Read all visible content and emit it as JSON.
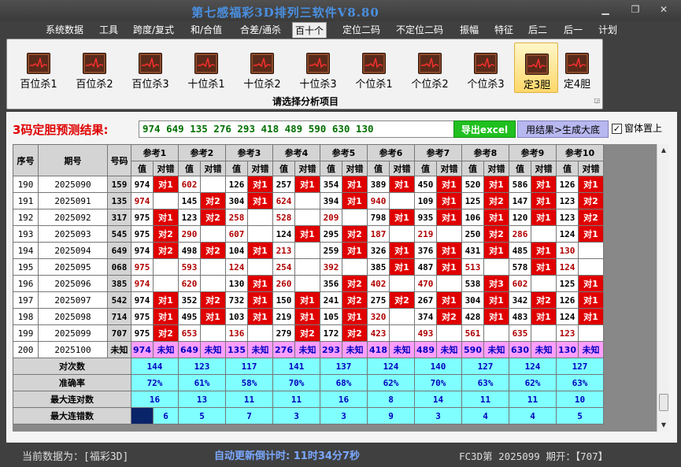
{
  "window": {
    "title": "第七感福彩3D排列三软件V8.80",
    "min_icon": "minimize-icon",
    "max_icon": "maximize-icon",
    "close_icon": "close-icon"
  },
  "menu": [
    "系统数据",
    "工具",
    "跨度/复式",
    "和/合值",
    "合差/通杀",
    "百十个",
    "定位二码",
    "不定位二码",
    "振幅",
    "特征",
    "后二",
    "后一",
    "计划"
  ],
  "menu_active": "百十个",
  "ribbon": {
    "buttons": [
      "百位杀1",
      "百位杀2",
      "百位杀3",
      "十位杀1",
      "十位杀2",
      "十位杀3",
      "个位杀1",
      "个位杀2",
      "个位杀3",
      "定3胆",
      "定4胆"
    ],
    "active": "定3胆",
    "caption": "请选择分析项目"
  },
  "prediction": {
    "label": "3码定胆预测结果:",
    "value": "974 649 135 276 293 418 489 590 630 130"
  },
  "buttons": {
    "export": "导出excel",
    "generate": "用结果>生成大底"
  },
  "ontop_label": "窗体置上",
  "ontop_checked": "✓",
  "table": {
    "headers": {
      "seq": "序号",
      "issue": "期号",
      "code": "号码",
      "value": "值",
      "check": "对错"
    },
    "refs": [
      "参考1",
      "参考2",
      "参考3",
      "参考4",
      "参考5",
      "参考6",
      "参考7",
      "参考8",
      "参考9",
      "参考10"
    ],
    "rows": [
      {
        "seq": "190",
        "issue": "2025090",
        "code": "159",
        "cells": [
          [
            "974",
            "对1"
          ],
          [
            "602",
            ""
          ],
          [
            "126",
            "对1"
          ],
          [
            "257",
            "对1"
          ],
          [
            "354",
            "对1"
          ],
          [
            "389",
            "对1"
          ],
          [
            "450",
            "对1"
          ],
          [
            "520",
            "对1"
          ],
          [
            "586",
            "对1"
          ],
          [
            "126",
            "对1"
          ]
        ]
      },
      {
        "seq": "191",
        "issue": "2025091",
        "code": "135",
        "cells": [
          [
            "974",
            ""
          ],
          [
            "145",
            "对2"
          ],
          [
            "304",
            "对1"
          ],
          [
            "624",
            ""
          ],
          [
            "394",
            "对1"
          ],
          [
            "940",
            ""
          ],
          [
            "109",
            "对1"
          ],
          [
            "125",
            "对2"
          ],
          [
            "147",
            "对1"
          ],
          [
            "123",
            "对2"
          ]
        ]
      },
      {
        "seq": "192",
        "issue": "2025092",
        "code": "317",
        "cells": [
          [
            "975",
            "对1"
          ],
          [
            "123",
            "对2"
          ],
          [
            "258",
            ""
          ],
          [
            "528",
            ""
          ],
          [
            "209",
            ""
          ],
          [
            "798",
            "对1"
          ],
          [
            "935",
            "对1"
          ],
          [
            "106",
            "对1"
          ],
          [
            "120",
            "对1"
          ],
          [
            "123",
            "对2"
          ]
        ]
      },
      {
        "seq": "193",
        "issue": "2025093",
        "code": "545",
        "cells": [
          [
            "975",
            "对2"
          ],
          [
            "290",
            ""
          ],
          [
            "607",
            ""
          ],
          [
            "124",
            "对1"
          ],
          [
            "295",
            "对2"
          ],
          [
            "187",
            ""
          ],
          [
            "219",
            ""
          ],
          [
            "250",
            "对2"
          ],
          [
            "286",
            ""
          ],
          [
            "124",
            "对1"
          ]
        ]
      },
      {
        "seq": "194",
        "issue": "2025094",
        "code": "649",
        "cells": [
          [
            "974",
            "对2"
          ],
          [
            "498",
            "对2"
          ],
          [
            "104",
            "对1"
          ],
          [
            "213",
            ""
          ],
          [
            "259",
            "对1"
          ],
          [
            "326",
            "对1"
          ],
          [
            "376",
            "对1"
          ],
          [
            "431",
            "对1"
          ],
          [
            "485",
            "对1"
          ],
          [
            "130",
            ""
          ]
        ]
      },
      {
        "seq": "195",
        "issue": "2025095",
        "code": "068",
        "cells": [
          [
            "975",
            ""
          ],
          [
            "593",
            ""
          ],
          [
            "124",
            ""
          ],
          [
            "254",
            ""
          ],
          [
            "392",
            ""
          ],
          [
            "385",
            "对1"
          ],
          [
            "487",
            "对1"
          ],
          [
            "513",
            ""
          ],
          [
            "578",
            "对1"
          ],
          [
            "124",
            ""
          ]
        ]
      },
      {
        "seq": "196",
        "issue": "2025096",
        "code": "385",
        "cells": [
          [
            "974",
            ""
          ],
          [
            "620",
            ""
          ],
          [
            "130",
            "对1"
          ],
          [
            "260",
            ""
          ],
          [
            "356",
            "对2"
          ],
          [
            "402",
            ""
          ],
          [
            "470",
            ""
          ],
          [
            "538",
            "对3"
          ],
          [
            "602",
            ""
          ],
          [
            "125",
            "对1"
          ]
        ]
      },
      {
        "seq": "197",
        "issue": "2025097",
        "code": "542",
        "cells": [
          [
            "974",
            "对1"
          ],
          [
            "352",
            "对2"
          ],
          [
            "732",
            "对1"
          ],
          [
            "150",
            "对1"
          ],
          [
            "241",
            "对2"
          ],
          [
            "275",
            "对2"
          ],
          [
            "267",
            "对1"
          ],
          [
            "304",
            "对1"
          ],
          [
            "342",
            "对2"
          ],
          [
            "126",
            "对1"
          ]
        ]
      },
      {
        "seq": "198",
        "issue": "2025098",
        "code": "714",
        "cells": [
          [
            "975",
            "对1"
          ],
          [
            "495",
            "对1"
          ],
          [
            "103",
            "对1"
          ],
          [
            "219",
            "对1"
          ],
          [
            "105",
            "对1"
          ],
          [
            "320",
            ""
          ],
          [
            "374",
            "对2"
          ],
          [
            "428",
            "对1"
          ],
          [
            "483",
            "对1"
          ],
          [
            "124",
            "对1"
          ]
        ]
      },
      {
        "seq": "199",
        "issue": "2025099",
        "code": "707",
        "cells": [
          [
            "975",
            "对2"
          ],
          [
            "653",
            ""
          ],
          [
            "136",
            ""
          ],
          [
            "279",
            "对2"
          ],
          [
            "172",
            "对2"
          ],
          [
            "423",
            ""
          ],
          [
            "493",
            ""
          ],
          [
            "561",
            ""
          ],
          [
            "635",
            ""
          ],
          [
            "123",
            ""
          ]
        ]
      }
    ],
    "pred_row": {
      "seq": "200",
      "issue": "2025100",
      "code": "未知",
      "cells": [
        [
          "974",
          "未知"
        ],
        [
          "649",
          "未知"
        ],
        [
          "135",
          "未知"
        ],
        [
          "276",
          "未知"
        ],
        [
          "293",
          "未知"
        ],
        [
          "418",
          "未知"
        ],
        [
          "489",
          "未知"
        ],
        [
          "590",
          "未知"
        ],
        [
          "630",
          "未知"
        ],
        [
          "130",
          "未知"
        ]
      ]
    },
    "stats": [
      {
        "label": "对次数",
        "values": [
          "144",
          "123",
          "117",
          "141",
          "137",
          "124",
          "140",
          "127",
          "124",
          "127"
        ]
      },
      {
        "label": "准确率",
        "values": [
          "72%",
          "61%",
          "58%",
          "70%",
          "68%",
          "62%",
          "70%",
          "63%",
          "62%",
          "63%"
        ]
      },
      {
        "label": "最大连对数",
        "values": [
          "16",
          "13",
          "11",
          "11",
          "16",
          "8",
          "14",
          "11",
          "11",
          "10"
        ]
      },
      {
        "label": "最大连错数",
        "values": [
          "6",
          "5",
          "7",
          "3",
          "3",
          "9",
          "3",
          "4",
          "4",
          "5"
        ]
      }
    ]
  },
  "scrollbar": {
    "up_icon": "scroll-up-arrow-icon",
    "down_icon": "scroll-down-arrow-icon"
  },
  "status": {
    "left": "当前数据为：[福彩3D]",
    "mid": "自动更新倒计时:  11时34分7秒",
    "right": "FC3D第 2025099 期开：【707】"
  }
}
